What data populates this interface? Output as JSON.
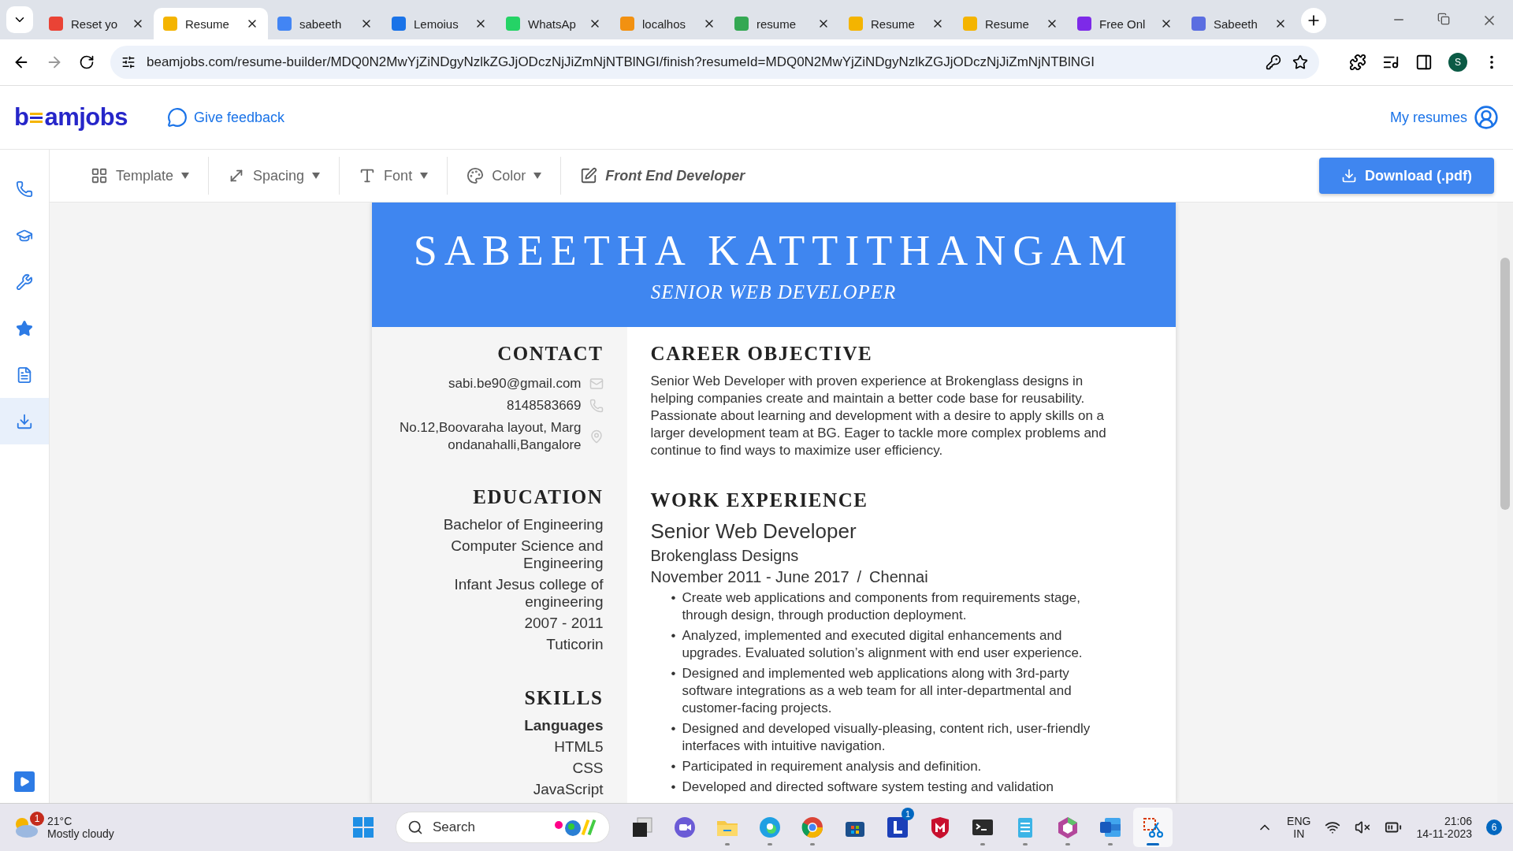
{
  "browser": {
    "tabs": [
      {
        "title": "Reset yo",
        "selected": false,
        "color": "#ea4335"
      },
      {
        "title": "Resume",
        "selected": true,
        "color": "#f4b400"
      },
      {
        "title": "sabeeth",
        "selected": false,
        "color": "#4285f4"
      },
      {
        "title": "Lemoius",
        "selected": false,
        "color": "#1a73e8"
      },
      {
        "title": "WhatsAp",
        "selected": false,
        "color": "#25d366"
      },
      {
        "title": "localhos",
        "selected": false,
        "color": "#f29111"
      },
      {
        "title": "resume",
        "selected": false,
        "color": "#34a853"
      },
      {
        "title": "Resume",
        "selected": false,
        "color": "#f4b400"
      },
      {
        "title": "Resume",
        "selected": false,
        "color": "#f4b400"
      },
      {
        "title": "Free Onl",
        "selected": false,
        "color": "#7d2ae8"
      },
      {
        "title": "Sabeeth",
        "selected": false,
        "color": "#5b6ee1"
      }
    ],
    "url": "beamjobs.com/resume-builder/MDQ0N2MwYjZiNDgyNzlkZGJjODczNjJiZmNjNTBlNGI/finish?resumeId=MDQ0N2MwYjZiNDgyNzlkZGJjODczNjJiZmNjNTBlNGI",
    "profile": "S"
  },
  "app": {
    "logo": [
      "b",
      "amjobs"
    ],
    "feedback": "Give feedback",
    "my_resumes": "My resumes"
  },
  "toolbar": {
    "items": [
      {
        "label": "Template",
        "kind": "dropdown"
      },
      {
        "label": "Spacing",
        "kind": "dropdown"
      },
      {
        "label": "Font",
        "kind": "dropdown"
      },
      {
        "label": "Color",
        "kind": "dropdown"
      },
      {
        "label": "Front End Developer",
        "kind": "title"
      }
    ],
    "download": "Download (.pdf)"
  },
  "sidebar": {
    "items": [
      {
        "selected": false
      },
      {
        "selected": false
      },
      {
        "selected": false
      },
      {
        "selected": false
      },
      {
        "selected": false
      },
      {
        "selected": true
      }
    ]
  },
  "resume": {
    "name": "SABEETHA KATTITHANGAM",
    "title": "SENIOR WEB DEVELOPER",
    "contact": {
      "heading": "CONTACT",
      "items": [
        {
          "kind": "email",
          "text": "sabi.be90@gmail.com"
        },
        {
          "kind": "phone",
          "text": "8148583669"
        },
        {
          "kind": "address",
          "text": "No.12,Boovaraha layout, Margondanahalli,Bangalore"
        }
      ]
    },
    "education": {
      "heading": "EDUCATION",
      "lines": [
        "Bachelor of Engineering",
        "Computer Science and Engineering",
        "Infant Jesus college of engineering",
        "2007 - 2011",
        "Tuticorin"
      ]
    },
    "skills": {
      "heading": "SKILLS",
      "group": "Languages",
      "items": [
        "HTML5",
        "CSS",
        "JavaScript"
      ]
    },
    "objective": {
      "heading": "CAREER OBJECTIVE",
      "text": "Senior Web Developer with proven experience at Brokenglass designs in helping companies create and maintain a better code base for reusability. Passionate about learning and development with a desire to apply skills on a larger development team at BG. Eager to tackle more complex problems and continue to find ways to maximize user efficiency."
    },
    "experience": {
      "heading": "WORK EXPERIENCE",
      "role": "Senior Web Developer",
      "company": "Brokenglass Designs",
      "dates": "November 2011 - June 2017",
      "separator": "/",
      "location": "Chennai",
      "marker": "•",
      "bullets": [
        "Create web applications and components from requirements stage, through design, through production deployment.",
        "Analyzed, implemented and executed digital enhancements and upgrades. Evaluated solution’s alignment with end user experience.",
        "Designed and implemented web applications along with 3rd-party software integrations as a web team for all inter-departmental and customer-facing projects.",
        "Designed and developed visually-pleasing, content rich, user-friendly interfaces with intuitive navigation.",
        " Participated in requirement analysis and definition.",
        "Developed and directed software system testing and validation"
      ]
    }
  },
  "taskbar": {
    "weather": {
      "badge": "1",
      "temp": "21°C",
      "condition": "Mostly cloudy"
    },
    "search": "Search",
    "apps": [
      {
        "running": false,
        "selected": false
      },
      {
        "running": false,
        "selected": false
      },
      {
        "running": true,
        "selected": false
      },
      {
        "running": true,
        "selected": false
      },
      {
        "running": true,
        "selected": false
      },
      {
        "running": false,
        "selected": false
      },
      {
        "running": false,
        "selected": false,
        "badge": "1"
      },
      {
        "running": false,
        "selected": false
      },
      {
        "running": true,
        "selected": false
      },
      {
        "running": true,
        "selected": false
      },
      {
        "running": true,
        "selected": false
      },
      {
        "running": true,
        "selected": false
      },
      {
        "running": true,
        "selected": true
      }
    ],
    "lang": [
      "ENG",
      "IN"
    ],
    "time": "21:06",
    "date": "14-11-2023",
    "notifications": "6"
  }
}
